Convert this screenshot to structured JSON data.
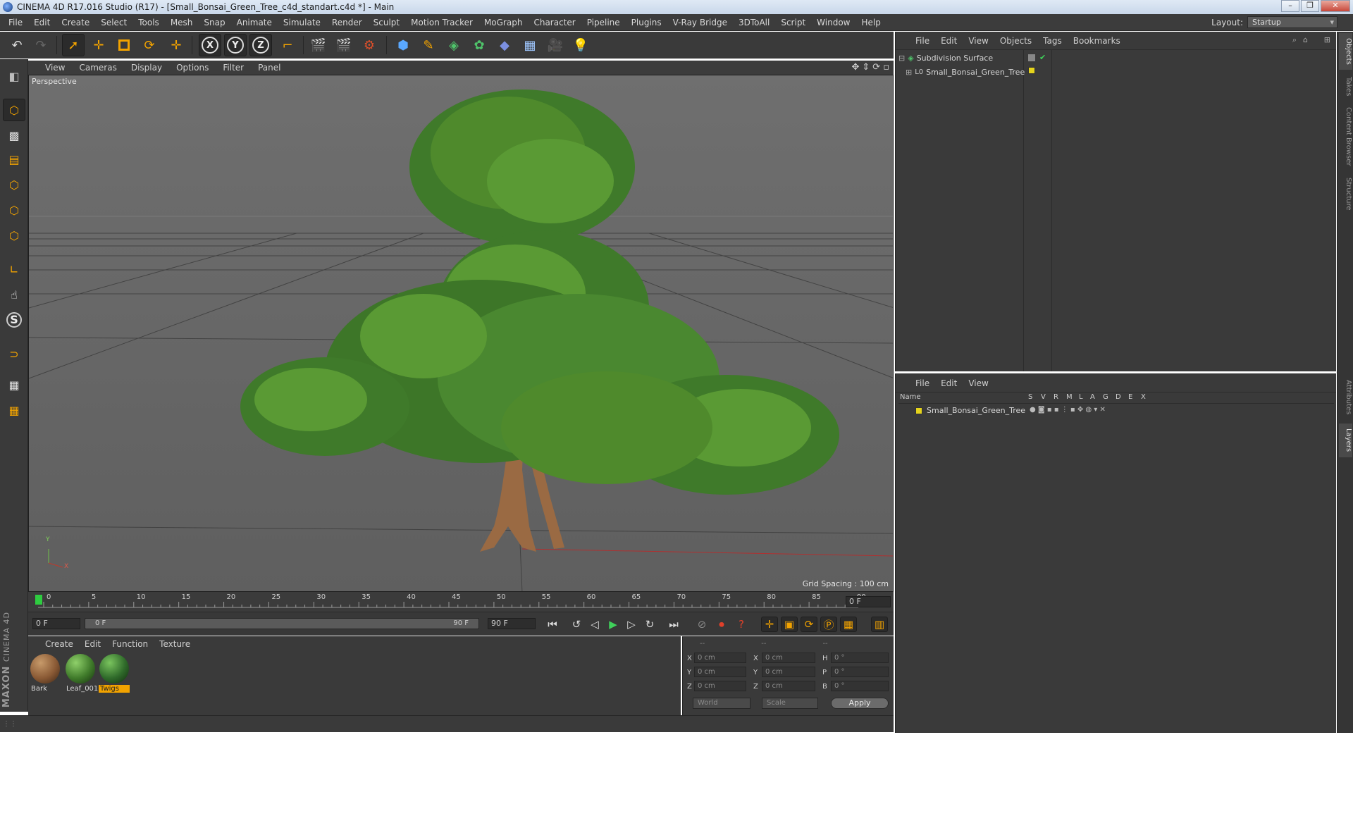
{
  "window": {
    "title": "CINEMA 4D R17.016 Studio (R17) - [Small_Bonsai_Green_Tree_c4d_standart.c4d *] - Main"
  },
  "menubar": {
    "items": [
      "File",
      "Edit",
      "Create",
      "Select",
      "Tools",
      "Mesh",
      "Snap",
      "Animate",
      "Simulate",
      "Render",
      "Sculpt",
      "Motion Tracker",
      "MoGraph",
      "Character",
      "Pipeline",
      "Plugins",
      "V-Ray Bridge",
      "3DToAll",
      "Script",
      "Window",
      "Help"
    ],
    "layout_label": "Layout:",
    "layout_value": "Startup"
  },
  "toolbar": {
    "axis_x": "X",
    "axis_y": "Y",
    "axis_z": "Z"
  },
  "viewport": {
    "menu": [
      "View",
      "Cameras",
      "Display",
      "Options",
      "Filter",
      "Panel"
    ],
    "camera_label": "Perspective",
    "grid_spacing": "Grid Spacing : 100 cm",
    "axis_y": "Y",
    "axis_x": "X"
  },
  "timeline": {
    "ticks": [
      "0",
      "5",
      "10",
      "15",
      "20",
      "25",
      "30",
      "35",
      "40",
      "45",
      "50",
      "55",
      "60",
      "65",
      "70",
      "75",
      "80",
      "85",
      "90"
    ],
    "current_frame": "0 F",
    "start_field": "0 F",
    "range_start": "0 F",
    "range_end": "90 F",
    "end_field": "90 F"
  },
  "material_manager": {
    "menu": [
      "Create",
      "Edit",
      "Function",
      "Texture"
    ],
    "materials": [
      {
        "name": "Bark",
        "color": "#8a5a35",
        "selected": false
      },
      {
        "name": "Leaf_001",
        "color": "#3f7a2a",
        "selected": false
      },
      {
        "name": "Twigs",
        "color": "#2f6a2a",
        "selected": true
      }
    ],
    "logo_line1": "MAXON",
    "logo_line2": "CINEMA 4D"
  },
  "coordinates": {
    "header": [
      "--",
      "--",
      "--"
    ],
    "rows": [
      {
        "a": "X",
        "av": "0 cm",
        "b": "X",
        "bv": "0 cm",
        "c": "H",
        "cv": "0 °"
      },
      {
        "a": "Y",
        "av": "0 cm",
        "b": "Y",
        "bv": "0 cm",
        "c": "P",
        "cv": "0 °"
      },
      {
        "a": "Z",
        "av": "0 cm",
        "b": "Z",
        "bv": "0 cm",
        "c": "B",
        "cv": "0 °"
      }
    ],
    "world": "World",
    "scale": "Scale",
    "apply": "Apply"
  },
  "object_manager": {
    "menu": [
      "File",
      "Edit",
      "View",
      "Objects",
      "Tags",
      "Bookmarks"
    ],
    "objects": [
      {
        "name": "Subdivision Surface"
      },
      {
        "name": "Small_Bonsai_Green_Tree"
      }
    ]
  },
  "layer_manager": {
    "menu": [
      "File",
      "Edit",
      "View"
    ],
    "columns": [
      "Name",
      "S",
      "V",
      "R",
      "M",
      "L",
      "A",
      "G",
      "D",
      "E",
      "X"
    ],
    "layers": [
      {
        "name": "Small_Bonsai_Green_Tree",
        "color": "#e5d31c"
      }
    ]
  },
  "side_tabs": [
    "Objects",
    "Takes",
    "Content Browser",
    "Structure",
    "Attributes",
    "Layers"
  ],
  "colors": {
    "accent": "#f2a300",
    "bg_panel": "#3a3a3a",
    "foliage": "#4f8a2c",
    "trunk": "#9a6a43"
  }
}
